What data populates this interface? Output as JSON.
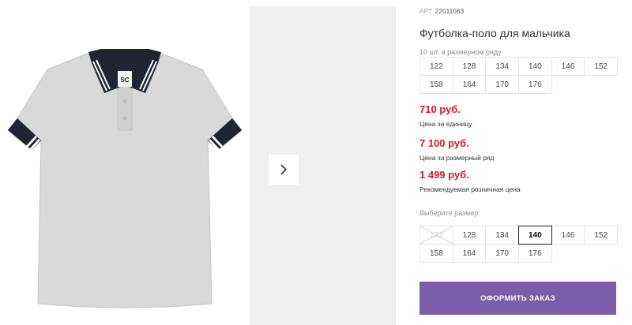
{
  "product": {
    "sku_label": "АРТ.",
    "sku_value": "22011063",
    "title": "Футболка-поло для мальчика",
    "set_note": "10 шт. в размерном ряду",
    "set_sizes": [
      "122",
      "128",
      "134",
      "140",
      "146",
      "152",
      "158",
      "164",
      "170",
      "176"
    ]
  },
  "prices": {
    "unit_price": "710 руб.",
    "unit_label": "Цена за единицу",
    "set_price": "7 100 руб.",
    "set_label": "Цена за размерный ряд",
    "retail_price": "1 499 руб.",
    "retail_label": "Рекомендуемая розничная цена",
    "accent_color": "#d0192b"
  },
  "size_select": {
    "label": "Выберите размер:",
    "options": [
      "122",
      "128",
      "134",
      "140",
      "146",
      "152",
      "158",
      "164",
      "170",
      "176"
    ],
    "disabled": "122",
    "selected": "140"
  },
  "gallery": {
    "next_icon": "chevron-right-icon",
    "collar_logo": "SC"
  },
  "order": {
    "button_label": "ОФОРМИТЬ ЗАКАЗ",
    "button_color": "#7b5ea7"
  }
}
